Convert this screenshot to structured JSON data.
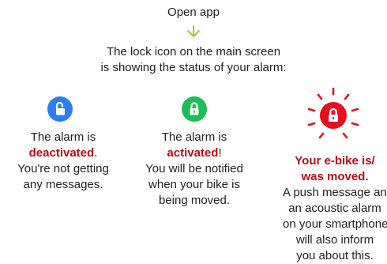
{
  "header": {
    "open_app": "Open app",
    "intro_line1": "The lock icon on the main screen",
    "intro_line2": "is showing the status of your alarm:"
  },
  "colors": {
    "deactivated": "#2d7ff0",
    "activated": "#1ebd55",
    "moved": "#e5101c",
    "arrow": "#9acd32",
    "emphasis": "#b80c17"
  },
  "statuses": [
    {
      "icon": "unlocked-padlock-icon",
      "line1": "The alarm is",
      "emphasis": "deactivated",
      "emphasis_suffix": ".",
      "line3": "You're not getting",
      "line4": "any messages."
    },
    {
      "icon": "locked-padlock-icon",
      "line1": "The alarm is",
      "emphasis": "activated",
      "emphasis_suffix": "!",
      "line3": "You will be notified",
      "line4": "when your bike is",
      "line5": "being moved."
    },
    {
      "icon": "alert-padlock-icon",
      "heading1": "Your e-bike is/",
      "heading2": "was moved.",
      "line3": "A push message and",
      "line4": "an acoustic alarm",
      "line5": "on your smartphone",
      "line6": "will also inform",
      "line7": "you about this."
    }
  ]
}
